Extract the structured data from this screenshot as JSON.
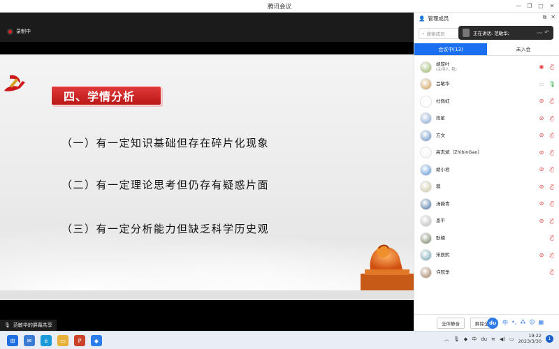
{
  "window": {
    "title": "腾讯会议"
  },
  "stage": {
    "recording_label": "录制中",
    "share_tag": "范敏华的屏幕共享"
  },
  "slide": {
    "heading": "四、学情分析",
    "points": [
      "（一）有一定知识基础但存在碎片化现象",
      "（二）有一定理论思考但仍存有疑惑片面",
      "（三）有一定分析能力但缺乏科学历史观"
    ]
  },
  "panel": {
    "title": "管理成员",
    "search_placeholder": "搜索成员",
    "speaking_label": "正在讲话: 范敏华;",
    "tabs": [
      "会议中(13)",
      "未入会"
    ],
    "participants": [
      {
        "name": "胡琼叶",
        "sub": "(主持人, 我)",
        "avatar_color": "#8fae5a",
        "icons": [
          "record-icon",
          "mic-muted-icon"
        ],
        "icon_colors": [
          "red",
          "red"
        ]
      },
      {
        "name": "吕敏华",
        "sub": "",
        "avatar_color": "#c9964a",
        "icons": [
          "screen-share-icon",
          "mic-icon"
        ],
        "icon_colors": [
          "gray",
          "green"
        ]
      },
      {
        "name": "杜佩虹",
        "sub": "",
        "avatar_color": "#ffffff",
        "icons": [
          "video-off-icon",
          "mic-muted-icon"
        ],
        "icon_colors": [
          "red",
          "red"
        ]
      },
      {
        "name": "段星",
        "sub": "",
        "avatar_color": "#7a9fd0",
        "icons": [
          "video-off-icon",
          "mic-muted-icon"
        ],
        "icon_colors": [
          "red",
          "red"
        ]
      },
      {
        "name": "方文",
        "sub": "",
        "avatar_color": "#5a88c0",
        "icons": [
          "video-off-icon",
          "mic-muted-icon"
        ],
        "icon_colors": [
          "red",
          "red"
        ]
      },
      {
        "name": "高志斌（ZhibinGao）",
        "sub": "",
        "avatar_color": "#f2f2f2",
        "icons": [
          "video-off-icon",
          "mic-muted-icon"
        ],
        "icon_colors": [
          "red",
          "red"
        ]
      },
      {
        "name": "胡小君",
        "sub": "",
        "avatar_color": "#4f8fd6",
        "icons": [
          "video-off-icon",
          "mic-muted-icon"
        ],
        "icon_colors": [
          "red",
          "red"
        ]
      },
      {
        "name": "蓉",
        "sub": "",
        "avatar_color": "#c8c09a",
        "icons": [
          "video-off-icon",
          "mic-muted-icon"
        ],
        "icon_colors": [
          "red",
          "red"
        ]
      },
      {
        "name": "汤薇青",
        "sub": "",
        "avatar_color": "#3c6a9c",
        "icons": [
          "video-off-icon",
          "mic-muted-icon"
        ],
        "icon_colors": [
          "red",
          "red"
        ]
      },
      {
        "name": "恩平",
        "sub": "",
        "avatar_color": "#b7b7b7",
        "icons": [
          "video-off-icon",
          "mic-muted-icon"
        ],
        "icon_colors": [
          "red",
          "red"
        ]
      },
      {
        "name": "耿楠",
        "sub": "",
        "avatar_color": "#6a7a5a",
        "icons": [
          "mic-muted-icon"
        ],
        "icon_colors": [
          "red"
        ]
      },
      {
        "name": "宋辰熙",
        "sub": "",
        "avatar_color": "#6aa0b0",
        "icons": [
          "video-off-icon",
          "mic-muted-icon"
        ],
        "icon_colors": [
          "red",
          "red"
        ]
      },
      {
        "name": "许冠争",
        "sub": "",
        "avatar_color": "#9a7050",
        "icons": [
          "mic-muted-icon"
        ],
        "icon_colors": [
          "red"
        ]
      }
    ],
    "footer": {
      "mute_all": "全体静音",
      "unmute_all": "解除全",
      "du_badge": "du",
      "ime_label": "中"
    }
  },
  "taskbar": {
    "time": "19:22",
    "date": "2023/3/30",
    "notification_count": "1"
  }
}
